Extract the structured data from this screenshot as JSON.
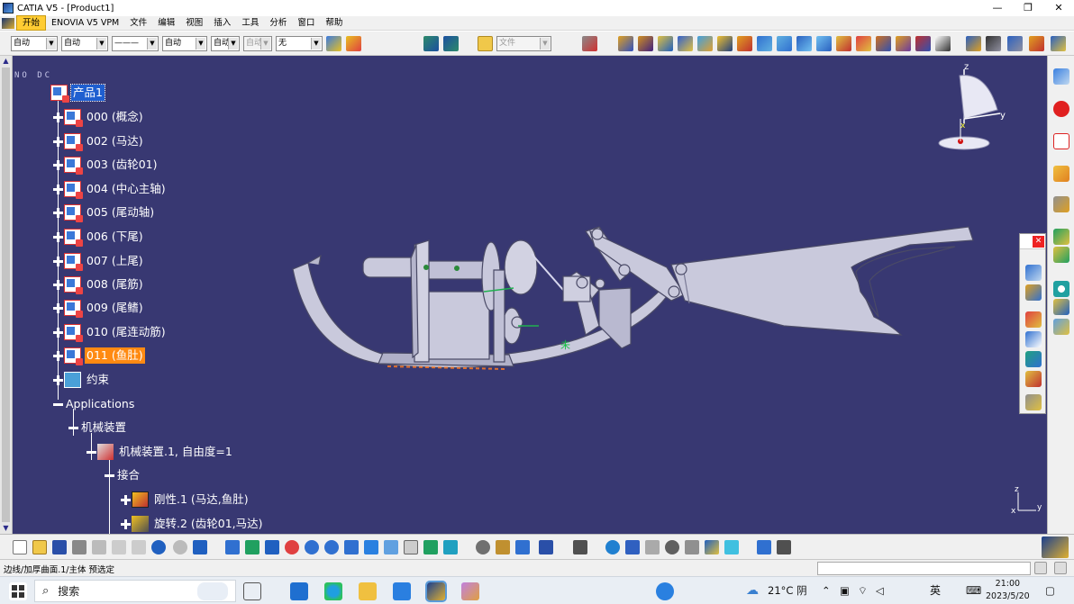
{
  "window": {
    "title": "CATIA V5 - [Product1]",
    "buttons": {
      "minimize": "—",
      "restore": "❐",
      "close": "✕"
    }
  },
  "menu": {
    "items": [
      "开始",
      "ENOVIA V5 VPM",
      "文件",
      "编辑",
      "视图",
      "插入",
      "工具",
      "分析",
      "窗口",
      "帮助"
    ],
    "active": "开始"
  },
  "style_toolbar": {
    "color": "自动",
    "transparency": "自动",
    "linetype": "———",
    "thickness": "自动",
    "point_symbol": "自动",
    "layer_disabled": "自动",
    "layer": "无",
    "file_combo": "文件"
  },
  "viewport": {
    "no_dc": "NO DC",
    "background": "#383872",
    "compass": {
      "z": "z",
      "y": "y",
      "x": "x"
    },
    "axis_small": {
      "z": "z",
      "y": "y",
      "x": "x"
    }
  },
  "tree": {
    "root": "产品1",
    "parts": [
      {
        "id": "p000",
        "label": "000 (概念)"
      },
      {
        "id": "p002",
        "label": "002 (马达)"
      },
      {
        "id": "p003",
        "label": "003 (齿轮01)"
      },
      {
        "id": "p004",
        "label": "004 (中心主轴)"
      },
      {
        "id": "p005",
        "label": "005 (尾动轴)"
      },
      {
        "id": "p006",
        "label": "006 (下尾)"
      },
      {
        "id": "p007",
        "label": "007 (上尾)"
      },
      {
        "id": "p008",
        "label": "008 (尾筋)"
      },
      {
        "id": "p009",
        "label": "009 (尾鳍)"
      },
      {
        "id": "p010",
        "label": "010 (尾连动筋)"
      },
      {
        "id": "p011",
        "label": "011 (鱼肚)"
      }
    ],
    "selected_part": "011 (鱼肚)",
    "constraints": "约束",
    "applications": "Applications",
    "mechanism_group": "机械装置",
    "mechanism": "机械装置.1, 自由度=1",
    "joints_group": "接合",
    "joints": [
      "刚性.1 (马达,鱼肚)",
      "旋转.2 (齿轮01,马达)"
    ]
  },
  "statusbar": {
    "message": "边线/加厚曲面.1/主体 预选定"
  },
  "taskbar": {
    "search": "搜索",
    "weather": "21°C 阴",
    "ime": "英",
    "time": "21:00",
    "date": "2023/5/20"
  },
  "colors": {
    "toolbar_bg": "#f0f0f0",
    "menu_active": "#ffcc33",
    "tree_selected": "#ff8a12",
    "model_face": "#c9c9dc",
    "model_edge": "#4a4a66"
  }
}
